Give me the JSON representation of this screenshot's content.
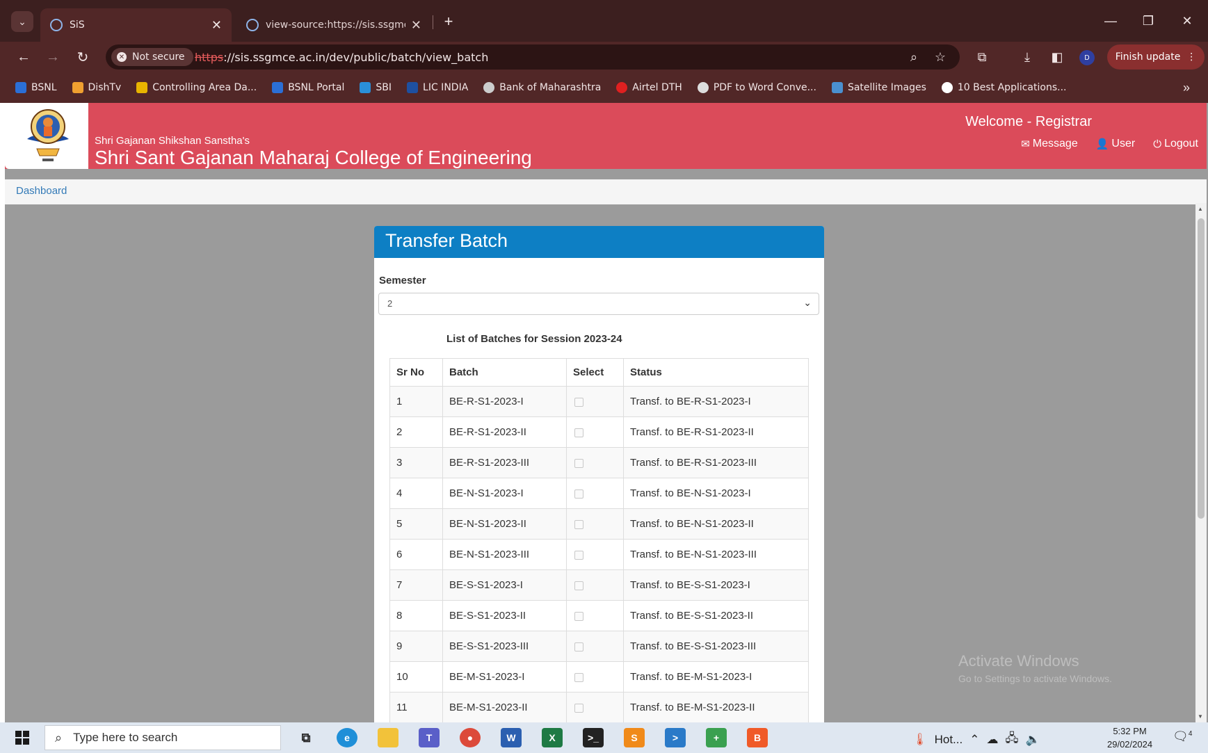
{
  "browser": {
    "tabs": [
      {
        "title": "SiS",
        "active": true
      },
      {
        "title": "view-source:https://sis.ssgmce.a",
        "active": false
      }
    ],
    "security_label": "Not secure",
    "url_scheme": "https",
    "url_rest": "://sis.ssgmce.ac.in/dev/public/batch/view_batch",
    "profile_initial": "D",
    "update_button": "Finish update",
    "bookmarks": [
      {
        "label": "BSNL",
        "color": "#2b6fd6"
      },
      {
        "label": "DishTv",
        "color": "#f0a030"
      },
      {
        "label": "Controlling Area Da...",
        "color": "#e8b400"
      },
      {
        "label": "BSNL Portal",
        "color": "#2b6fd6"
      },
      {
        "label": "SBI",
        "color": "#2a8fd8"
      },
      {
        "label": "LIC INDIA",
        "color": "#1e50a0"
      },
      {
        "label": "Bank of Maharashtra",
        "color": "#cccccc"
      },
      {
        "label": "Airtel DTH",
        "color": "#e02020"
      },
      {
        "label": "PDF to Word Conve...",
        "color": "#dddddd"
      },
      {
        "label": "Satellite Images",
        "color": "#4a90d0"
      },
      {
        "label": "10 Best Applications...",
        "color": "#ffffff"
      }
    ]
  },
  "header": {
    "sanstha": "Shri Gajanan Shikshan Sanstha's",
    "college": "Shri Sant Gajanan Maharaj College of Engineering",
    "welcome": "Welcome - Registrar",
    "message": "Message",
    "user": "User",
    "logout": "Logout"
  },
  "breadcrumb": {
    "dashboard": "Dashboard"
  },
  "panel": {
    "title": "Transfer Batch",
    "semester_label": "Semester",
    "semester_value": "2",
    "list_caption": "List of Batches for Session 2023-24",
    "columns": [
      "Sr No",
      "Batch",
      "Select",
      "Status"
    ],
    "rows": [
      {
        "sr": "1",
        "batch": "BE-R-S1-2023-I",
        "status": "Transf. to BE-R-S1-2023-I"
      },
      {
        "sr": "2",
        "batch": "BE-R-S1-2023-II",
        "status": "Transf. to BE-R-S1-2023-II"
      },
      {
        "sr": "3",
        "batch": "BE-R-S1-2023-III",
        "status": "Transf. to BE-R-S1-2023-III"
      },
      {
        "sr": "4",
        "batch": "BE-N-S1-2023-I",
        "status": "Transf. to BE-N-S1-2023-I"
      },
      {
        "sr": "5",
        "batch": "BE-N-S1-2023-II",
        "status": "Transf. to BE-N-S1-2023-II"
      },
      {
        "sr": "6",
        "batch": "BE-N-S1-2023-III",
        "status": "Transf. to BE-N-S1-2023-III"
      },
      {
        "sr": "7",
        "batch": "BE-S-S1-2023-I",
        "status": "Transf. to BE-S-S1-2023-I"
      },
      {
        "sr": "8",
        "batch": "BE-S-S1-2023-II",
        "status": "Transf. to BE-S-S1-2023-II"
      },
      {
        "sr": "9",
        "batch": "BE-S-S1-2023-III",
        "status": "Transf. to BE-S-S1-2023-III"
      },
      {
        "sr": "10",
        "batch": "BE-M-S1-2023-I",
        "status": "Transf. to BE-M-S1-2023-I"
      },
      {
        "sr": "11",
        "batch": "BE-M-S1-2023-II",
        "status": "Transf. to BE-M-S1-2023-II"
      }
    ]
  },
  "watermark": {
    "line1": "Activate Windows",
    "line2": "Go to Settings to activate Windows."
  },
  "taskbar": {
    "search_placeholder": "Type here to search",
    "weather": "Hot...",
    "time": "5:32 PM",
    "date": "29/02/2024",
    "notification_count": "4"
  }
}
